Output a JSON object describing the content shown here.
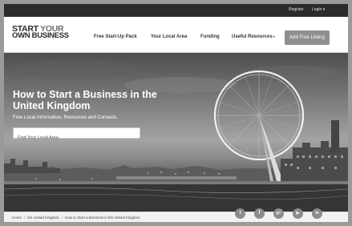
{
  "topbar": {
    "register": "Register",
    "login": "Login",
    "login_caret": "▾"
  },
  "logo": {
    "line1_a": "START",
    "line1_b": "YOUR",
    "line2": "OWN BUSINESS"
  },
  "nav": [
    {
      "label": "Free Start-Up Pack"
    },
    {
      "label": "Your Local Area"
    },
    {
      "label": "Funding"
    },
    {
      "label": "Useful Resources"
    }
  ],
  "nav_caret": "▾",
  "cta": {
    "label": "Add Free Listing"
  },
  "hero": {
    "title": "How to Start a Business in the United Kingdom",
    "subtitle": "Free Local Information, Resources and Contacts.",
    "search_placeholder": "Find Your Local Area"
  },
  "breadcrumb": [
    "Home",
    "the United Kingdom",
    "How to Start a Business in the United Kingdom"
  ],
  "breadcrumb_sep": "/",
  "social": [
    {
      "icon": "twitter-icon",
      "glyph": "t"
    },
    {
      "icon": "facebook-icon",
      "glyph": "f"
    },
    {
      "icon": "google-plus-icon",
      "glyph": "g+"
    },
    {
      "icon": "youtube-icon",
      "glyph": "▶"
    },
    {
      "icon": "linkedin-icon",
      "glyph": "in"
    }
  ]
}
